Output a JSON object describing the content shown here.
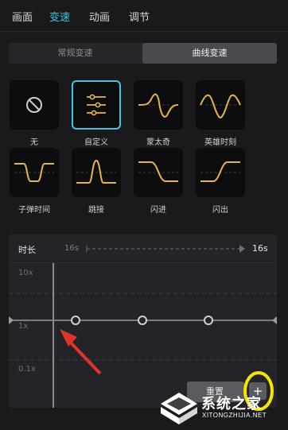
{
  "top_tabs": [
    "画面",
    "变速",
    "动画",
    "调节"
  ],
  "active_top_tab": "变速",
  "speed_modes": {
    "normal": "常规变速",
    "curve": "曲线变速",
    "selected": "曲线变速"
  },
  "presets": [
    {
      "label": "无",
      "icon": "none-circle-icon"
    },
    {
      "label": "自定义",
      "icon": "custom-sliders-icon",
      "selected": true
    },
    {
      "label": "蒙太奇",
      "icon": "montage-curve-icon"
    },
    {
      "label": "英雄时刻",
      "icon": "hero-moment-curve-icon"
    },
    {
      "label": "子弹时间",
      "icon": "bullet-time-curve-icon"
    },
    {
      "label": "跳接",
      "icon": "jump-cut-curve-icon"
    },
    {
      "label": "闪进",
      "icon": "flash-in-curve-icon"
    },
    {
      "label": "闪出",
      "icon": "flash-out-curve-icon"
    }
  ],
  "editor": {
    "duration_label": "时长",
    "duration_source": "16s",
    "duration_target": "16s",
    "y_axis_labels": [
      "10x",
      "1x",
      "0.1x"
    ],
    "control_points_speed": [
      1,
      1,
      1,
      1
    ],
    "reset_label": "重置",
    "add_point_label": "+"
  },
  "colors": {
    "accent": "#3ec7e2",
    "curve_preset": "#e3b54a",
    "annotation_arrow": "#e0342b",
    "annotation_circle": "#f2e600"
  },
  "watermark": {
    "title": "系统之家",
    "subtitle": "XITONGZHIJIA.NET"
  }
}
